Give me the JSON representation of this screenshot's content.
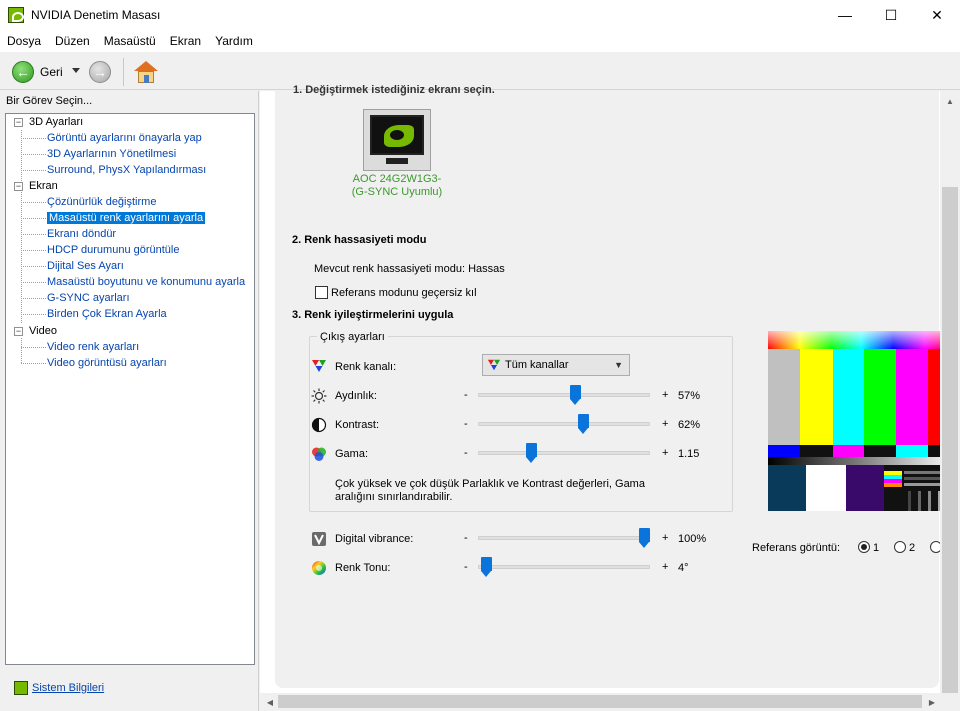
{
  "window": {
    "title": "NVIDIA Denetim Masası",
    "controls": {
      "minimize": "—",
      "maximize": "☐",
      "close": "✕"
    }
  },
  "menu": [
    "Dosya",
    "Düzen",
    "Masaüstü",
    "Ekran",
    "Yardım"
  ],
  "toolbar": {
    "back_label": "Geri",
    "back_glyph": "←",
    "forward_glyph": "→",
    "icons": [
      "back-arrow-icon",
      "dropdown-arrow-icon",
      "forward-arrow-icon",
      "home-icon"
    ]
  },
  "sidebar": {
    "header": "Bir Görev Seçin...",
    "groups": [
      {
        "label": "3D Ayarları",
        "expander": "−",
        "items": [
          "Görüntü ayarlarını önayarla yap",
          "3D Ayarlarının Yönetilmesi",
          "Surround, PhysX Yapılandırması"
        ]
      },
      {
        "label": "Ekran",
        "expander": "−",
        "items": [
          "Çözünürlük değiştirme",
          "Masaüstü renk ayarlarını ayarla",
          "Ekranı döndür",
          "HDCP durumunu görüntüle",
          "Dijital Ses Ayarı",
          "Masaüstü boyutunu ve konumunu ayarla",
          "G-SYNC ayarları",
          "Birden Çok Ekran Ayarla"
        ]
      },
      {
        "label": "Video",
        "expander": "−",
        "items": [
          "Video renk ayarları",
          "Video görüntüsü ayarları"
        ]
      }
    ],
    "selected_item": "Masaüstü renk ayarlarını ayarla",
    "footer_link": "Sistem Bilgileri"
  },
  "main": {
    "cut_heading": "1. Değiştirmek istediğiniz ekranı seçin.",
    "monitor_label_1": "AOC 24G2W1G3-",
    "monitor_label_2": "(G-SYNC Uyumlu)",
    "section2_title": "2. Renk hassasiyeti modu",
    "current_mode": "Mevcut renk hassasiyeti modu: Hassas",
    "override_checkbox_label": "Referans modunu geçersiz kıl",
    "override_checked": false,
    "section3_title": "3. Renk iyileştirmelerini uygula",
    "output_group_label": "Çıkış ayarları",
    "channel_label": "Renk kanalı:",
    "channel_value": "Tüm kanallar",
    "sliders": {
      "brightness": {
        "label": "Aydınlık:",
        "value_text": "57%",
        "fraction": 0.57
      },
      "contrast": {
        "label": "Kontrast:",
        "value_text": "62%",
        "fraction": 0.62
      },
      "gamma": {
        "label": "Gama:",
        "value_text": "1.15",
        "fraction": 0.3
      },
      "vibrance": {
        "label": "Digital vibrance:",
        "value_text": "100%",
        "fraction": 1.0
      },
      "hue": {
        "label": "Renk Tonu:",
        "value_text": "4°",
        "fraction": 0.02
      }
    },
    "minus_sign": "-",
    "plus_sign": "+",
    "note_line1": "Çok yüksek ve çok düşük Parlaklık ve Kontrast değerleri, Gama",
    "note_line2": "aralığını sınırlandırabilir.",
    "reference_label": "Referans görüntü:",
    "reference_options": [
      "1",
      "2"
    ],
    "reference_selected": "1"
  },
  "colors": {
    "nvidia_green": "#76b900",
    "link_blue": "#0645ad",
    "selection_blue": "#0078d7",
    "slider_blue": "#0a74da",
    "monitor_label_green": "#3a9a2a"
  }
}
